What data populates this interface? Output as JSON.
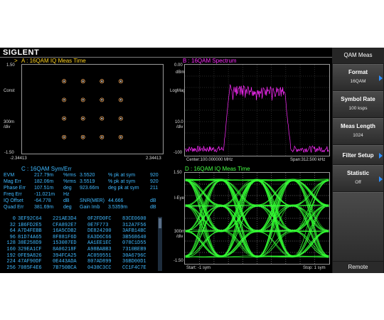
{
  "brand": "SIGLENT",
  "colors": {
    "constellation": "#ffb060",
    "spectrum": "#ff2bff",
    "eye": "#33ff33",
    "meas_text": "#3fb9ff",
    "menu_arrow": "#2e8fff"
  },
  "panelA": {
    "marker": ">",
    "title": "A : 16QAM  IQ Meas Time",
    "y_labels": {
      "top": "1.50",
      "ref": "Const",
      "mid": "300m",
      "div": "/div",
      "bottom": "-1.50"
    },
    "x_left": "-2.34413",
    "x_right": "2.34413",
    "points": [
      [
        -3,
        3
      ],
      [
        -1,
        3
      ],
      [
        1,
        3
      ],
      [
        3,
        3
      ],
      [
        -3,
        1
      ],
      [
        -1,
        1
      ],
      [
        1,
        1
      ],
      [
        3,
        1
      ],
      [
        -3,
        -1
      ],
      [
        -1,
        -1
      ],
      [
        1,
        -1
      ],
      [
        3,
        -1
      ],
      [
        -3,
        -3
      ],
      [
        -1,
        -3
      ],
      [
        1,
        -3
      ],
      [
        3,
        -3
      ]
    ]
  },
  "panelB": {
    "title": "B : 16QAM  Spectrum",
    "y_labels": {
      "top": "0.00",
      "unit": "dBm",
      "scale": "LogMag",
      "mid": "10.0",
      "div": "/div",
      "bottom": "-100"
    },
    "center": "Center:100.000000 MHz",
    "span": "Span:312.500 kHz"
  },
  "panelC": {
    "title": "C : 16QAM  Sym/Err",
    "rows": [
      [
        "EVM",
        "217.79m",
        "%rms",
        "3.5520",
        "% pk at sym",
        "920"
      ],
      [
        "Mag Err",
        "182.06m",
        "%rms",
        "3.5519",
        "% pk at sym",
        "920"
      ],
      [
        "Phase Err",
        "107.51m",
        "deg",
        "923.66m",
        "deg pk at sym",
        "211"
      ],
      [
        "Freq Err",
        "-11.021m",
        "Hz",
        "",
        "",
        ""
      ],
      [
        "IQ Offset",
        "-64.778",
        "dB",
        "SNR(MER)",
        "44.666",
        "dB"
      ],
      [
        "Quad Err",
        "381.69m",
        "deg",
        "Gain Imb",
        "3.5359m",
        "dB"
      ]
    ],
    "symbols": [
      [
        "0",
        "3EF92C64",
        "221AE3D4",
        "0F2FD0FC",
        "83CE0600"
      ],
      [
        "32",
        "1B6FD2E5",
        "CFA892E7",
        "0E7F773",
        "312A7F56"
      ],
      [
        "64",
        "A7D4FEBB",
        "16A5CDB2",
        "DE824200",
        "3AFB14BC"
      ],
      [
        "96",
        "81D74A65",
        "8F881F6D",
        "EA3D6C66",
        "3B568640"
      ],
      [
        "128",
        "38E258D9",
        "153087ED",
        "AA1EE1EC",
        "078C1D55"
      ],
      [
        "160",
        "329EA1CF",
        "8A06218F",
        "A98BABB3",
        "7310BEB9"
      ],
      [
        "192",
        "0FE9A826",
        "394FCA25",
        "AC059551",
        "30A6796C"
      ],
      [
        "224",
        "47AF90DF",
        "0E443ADA",
        "807AD899",
        "36BD00D1"
      ],
      [
        "256",
        "7085F4E6",
        "7B750BCA",
        "0438C3CC",
        "CC1F4C7E"
      ]
    ]
  },
  "panelD": {
    "title": "D : 16QAM  IQ Meas Time",
    "y_labels": {
      "top": "1.50",
      "ref": "I-Eye",
      "mid": "300m",
      "div": "/div",
      "bottom": "-1.50"
    },
    "start": "Start: -1 sym",
    "stop": "Stop: 1 sym"
  },
  "menu": {
    "title": "QAM Meas",
    "items": [
      {
        "label": "Format",
        "value": "16QAM",
        "arrow": true
      },
      {
        "label": "Symbol Rate",
        "value": "100 ksps",
        "arrow": false
      },
      {
        "label": "Meas Length",
        "value": "1024",
        "arrow": false
      },
      {
        "label": "Filter Setup",
        "value": "",
        "arrow": true
      },
      {
        "label": "Statistic",
        "value": "Off",
        "arrow": true
      }
    ],
    "remote": "Remote"
  }
}
